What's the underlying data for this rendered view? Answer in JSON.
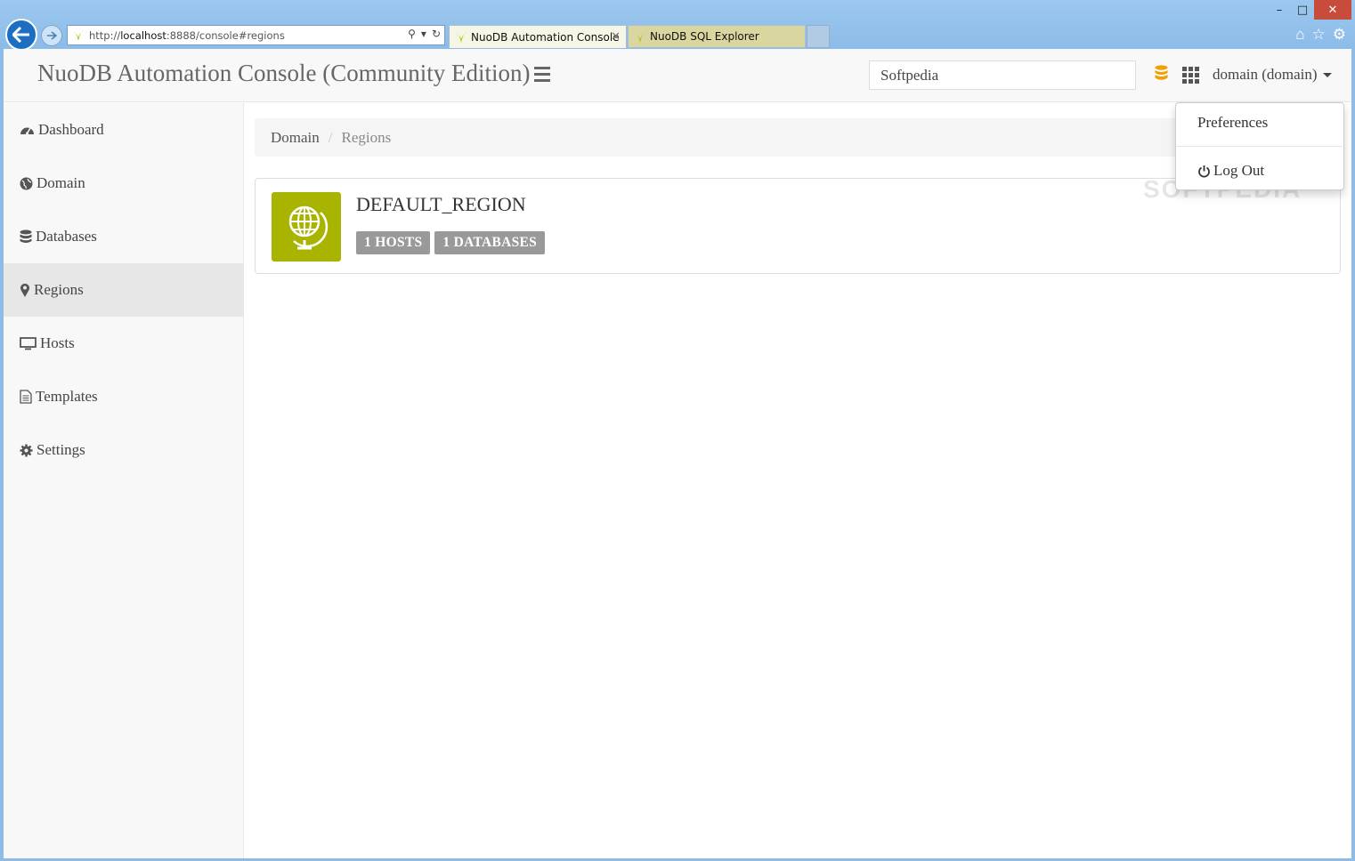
{
  "browser": {
    "url_prefix": "http://",
    "url_host": "localhost",
    "url_rest": ":8888/console#regions",
    "tabs": [
      {
        "label": "NuoDB Automation Console"
      },
      {
        "label": "NuoDB SQL Explorer"
      }
    ]
  },
  "navbar": {
    "brand": "NuoDB Automation Console (Community Edition)",
    "search_value": "Softpedia",
    "user_label": "domain (domain)"
  },
  "sidebar": {
    "items": [
      {
        "label": "Dashboard",
        "icon": "dashboard-icon"
      },
      {
        "label": "Domain",
        "icon": "globe-icon"
      },
      {
        "label": "Databases",
        "icon": "database-icon"
      },
      {
        "label": "Regions",
        "icon": "map-marker-icon"
      },
      {
        "label": "Hosts",
        "icon": "monitor-icon"
      },
      {
        "label": "Templates",
        "icon": "file-icon"
      },
      {
        "label": "Settings",
        "icon": "gear-icon"
      }
    ],
    "active": "Regions"
  },
  "breadcrumb": {
    "root": "Domain",
    "current": "Regions"
  },
  "region": {
    "name": "DEFAULT_REGION",
    "hosts_badge": "1 HOSTS",
    "databases_badge": "1 DATABASES"
  },
  "user_dropdown": {
    "preferences": "Preferences",
    "logout": "Log Out"
  },
  "watermark": "SOFTPEDIA",
  "colors": {
    "region_icon_bg": "#a8b400",
    "db_icon": "#f0a000",
    "active_nav": "#e7e7e7"
  }
}
